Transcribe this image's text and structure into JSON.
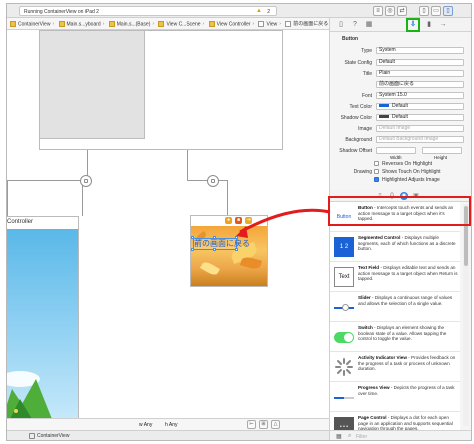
{
  "titlebar": {
    "status": "Running ContainerView on iPad 2",
    "warning_count": "2"
  },
  "jumpbar": {
    "crumbs": [
      "ContainerView",
      "Main.s...yboard",
      "Main.s...(Base)",
      "View C...Scene",
      "View Controller",
      "View",
      "前の画面に戻る"
    ]
  },
  "canvas": {
    "scene_left_title": "Controller",
    "selected_button_label": "前の画面に戻る"
  },
  "bottombar": {
    "w_any": "w Any",
    "h_any": "h Any"
  },
  "statusbar": {
    "label": "ContainerView"
  },
  "inspector": {
    "section": "Button",
    "rows": [
      {
        "label": "Type",
        "value": "System"
      },
      {
        "label": "State Config",
        "value": "Default"
      },
      {
        "label": "Title",
        "value": "Plain"
      },
      {
        "label": "",
        "value": "前の画面に戻る"
      },
      {
        "label": "Font",
        "value": "System 15.0"
      },
      {
        "label": "Text Color",
        "value": "Default"
      },
      {
        "label": "Shadow Color",
        "value": "Default"
      },
      {
        "label": "Image",
        "value": "Default Image",
        "placeholder": true
      },
      {
        "label": "Background",
        "value": "Default Background Image",
        "placeholder": true
      }
    ],
    "shadow_offset_label": "Shadow Offset",
    "width_label": "Width",
    "height_label": "Height",
    "drawing_label": "Drawing",
    "checks": [
      {
        "label": "Reverses On Highlight",
        "checked": false
      },
      {
        "label": "Shows Touch On Highlight",
        "checked": false
      },
      {
        "label": "Highlighted Adjusts Image",
        "checked": true
      }
    ],
    "colors": {
      "text_color": "#1a62d6",
      "shadow_color": "#444444"
    }
  },
  "library": {
    "items": [
      {
        "name": "Button",
        "desc": " - Intercepts touch events and sends an action message to a target object when it's tapped.",
        "icon": "button-icon",
        "icon_text": "Button"
      },
      {
        "name": "Segmented Control",
        "desc": " - Displays multiple segments, each of which functions as a discrete button.",
        "icon": "segmented-control-icon",
        "icon_text": "1 2"
      },
      {
        "name": "Text Field",
        "desc": " - Displays editable text and sends an action message to a target object when Return is tapped.",
        "icon": "text-field-icon",
        "icon_text": "Text"
      },
      {
        "name": "Slider",
        "desc": " - Displays a continuous range of values and allows the selection of a single value.",
        "icon": "slider-icon",
        "icon_text": ""
      },
      {
        "name": "Switch",
        "desc": " - Displays an element showing the boolean state of a value. Allows tapping the control to toggle the value.",
        "icon": "switch-icon",
        "icon_text": ""
      },
      {
        "name": "Activity Indicator View",
        "desc": " - Provides feedback on the progress of a task or process of unknown duration.",
        "icon": "activity-indicator-icon",
        "icon_text": ""
      },
      {
        "name": "Progress View",
        "desc": " - Depicts the progress of a task over time.",
        "icon": "progress-view-icon",
        "icon_text": ""
      },
      {
        "name": "Page Control",
        "desc": " - Displays a dot for each open page in an application and supports sequential navigation through the pages.",
        "icon": "page-control-icon",
        "icon_text": "• • •"
      }
    ]
  },
  "filter": {
    "placeholder": "Filter"
  },
  "accent": {
    "highlight": "#e21b1b",
    "active_tab": "#19b316",
    "arrow": "#e21b1b"
  }
}
